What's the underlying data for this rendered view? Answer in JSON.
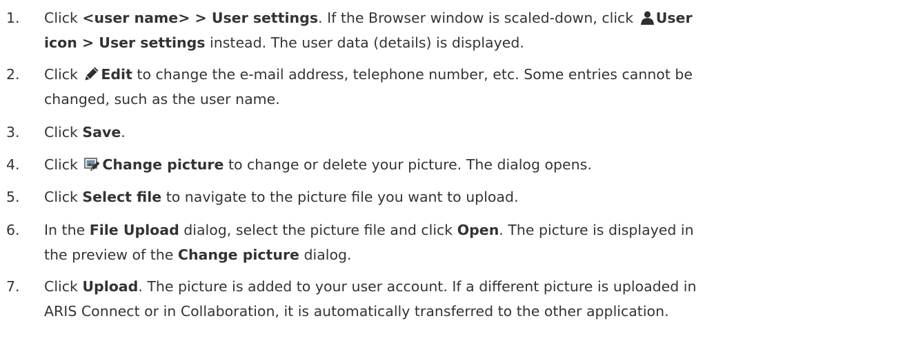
{
  "steps": [
    {
      "number": "1.",
      "t1": "Click ",
      "b1": "<user name> > User settings",
      "t2": ". If the Browser window is scaled-down, click ",
      "icon": "user-icon",
      "b2": "User",
      "b3": "icon > User settings",
      "t3": " instead. The user data (details) is displayed."
    },
    {
      "number": "2.",
      "t1": "Click ",
      "icon": "pencil-edit-icon",
      "b1": "Edit",
      "t2": " to change the e-mail address, telephone number, etc. Some entries cannot be",
      "t3": "changed, such as the user name."
    },
    {
      "number": "3.",
      "t1": "Click ",
      "b1": "Save",
      "t2": "."
    },
    {
      "number": "4.",
      "t1": "Click ",
      "icon": "change-picture-icon",
      "b1": "Change picture",
      "t2": " to change or delete your picture. The dialog opens."
    },
    {
      "number": "5.",
      "t1": "Click ",
      "b1": "Select file",
      "t2": " to navigate to the picture file you want to upload."
    },
    {
      "number": "6.",
      "t1": "In the ",
      "b1": "File Upload",
      "t2": " dialog, select the picture file and click ",
      "b2": "Open",
      "t3": ". The picture is displayed in",
      "t4": "the preview of the ",
      "b3": "Change picture",
      "t5": " dialog."
    },
    {
      "number": "7.",
      "t1": "Click ",
      "b1": "Upload",
      "t2": ". The picture is added to your user account. If a different picture is uploaded in",
      "t3": "ARIS Connect or in Collaboration, it is automatically transferred to the other application."
    }
  ]
}
